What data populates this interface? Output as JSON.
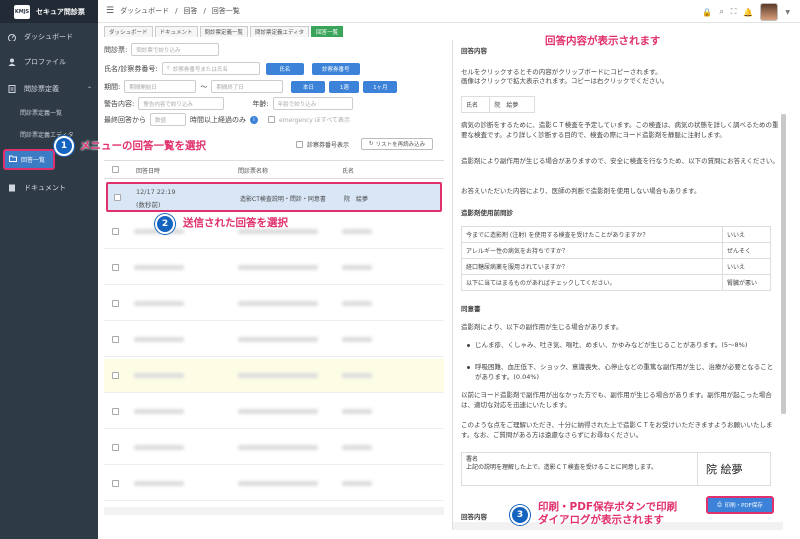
{
  "app": {
    "name": "セキュア問診票",
    "logo": "KMJS"
  },
  "sidebar": {
    "items": [
      {
        "label": "ダッシュボード",
        "icon": "dashboard-icon"
      },
      {
        "label": "プロファイル",
        "icon": "user-icon"
      },
      {
        "label": "問診票定義",
        "icon": "doc-icon"
      }
    ],
    "subitems": [
      "問診票定義一覧",
      "問診票定義エディタ"
    ],
    "active": "回答一覧",
    "document": "ドキュメント"
  },
  "breadcrumb": [
    "ダッシュボード",
    "回答",
    "回答一覧"
  ],
  "tabs": [
    "ダッシュボード",
    "ドキュメント",
    "問診票定義一覧",
    "問診票定義エディタ",
    "回答一覧"
  ],
  "filters": {
    "questionnaire_label": "問診票:",
    "questionnaire_ph": "問診票で絞り込み",
    "name_label": "氏名/診察券番号:",
    "name_ph": "診察券番号または氏名",
    "name_btn": "氏名",
    "card_btn": "診察券番号",
    "period_label": "期間:",
    "period_from_ph": "期間開始日",
    "tilde": "〜",
    "period_to_ph": "期間終了日",
    "today_btn": "本日",
    "week_btn": "1週",
    "month_btn": "1ヶ月",
    "warning_label": "警告内容:",
    "warning_ph": "警告内容で絞り込み",
    "age_label": "年齢:",
    "age_ph": "年齢で絞り込み",
    "last_label": "最終回答から",
    "last_ph": "数値",
    "hours_label": "時間以上経過のみ",
    "emergency": "emergency ほすべて表示",
    "show_card": "診察券番号表示",
    "reload": "リストを再読み込み"
  },
  "table": {
    "headers": [
      "回答日時",
      "問診票名称",
      "氏名"
    ],
    "selected": {
      "datetime": "12/17 22:19",
      "relative": "(数秒前)",
      "name": "造影CT検査説明・問診・同意書",
      "patient": "院　絵夢"
    }
  },
  "right": {
    "title": "回答内容",
    "intro1": "セルをクリックするとその内容がクリップボードにコピーされます。",
    "intro2": "画像はクリックで拡大表示されます。コピーは右クリックでください。",
    "name_label": "氏名",
    "name_value": "院　絵夢",
    "p1": "病気の診断をするために、造影ＣＴ検査を予定しています。この検査は、病気の状態を詳しく調べるための重要な検査です。より詳しく診断する目的で、検査の際にヨード造影剤を静脈に注射します。",
    "p2": "造影剤により副作用が生じる場合がありますので、安全に検査を行なうため、以下の質問にお答えください。",
    "p3": "お答えいただいた内容により、医師の判断で造影剤を使用しない場合もあります。",
    "sec1": "造影剤使用前問診",
    "qa": [
      [
        "今までに造影剤 (注射) を使用する検査を受けたことがありますか？",
        "いいえ"
      ],
      [
        "アレルギー性の病気をお持ちですか？",
        "ぜんそく"
      ],
      [
        "経口糖尿病薬を服用されていますか？",
        "いいえ"
      ],
      [
        "以下に当てはまるものがあればチェックしてください。",
        "腎臓が悪い"
      ]
    ],
    "sec2": "同意書",
    "p4": "造影剤により、以下の副作用が生じる場合があります。",
    "b1": "じんま疹、くしゃみ、吐き気、嘔吐、めまい、かゆみなどが生じることがあります。(5〜8%)",
    "b2": "呼吸困難、血圧低下、ショック、意識喪失、心停止などの重篤な副作用が生じ、治療が必要となることがあります。(0.04%)",
    "p5": "以前にヨード造影剤で副作用が出なかった方でも、副作用が生じる場合があります。副作用が起こった場合は、適切な対応を迅速にいたします。",
    "p6": "このような点をご理解いただき、十分に納得された上で造影ＣＴをお受けいただきますようお願いいたします。なお、ご質問がある方は遠慮なさらずにお尋ねください。",
    "sig_label": "署名",
    "sig_text": "上記の説明を理解した上で、造影ＣＴ検査を受けることに同意します。",
    "sig_value": "院 絵夢",
    "next_title": "回答内容",
    "print_btn": "印刷・PDF保存"
  },
  "annotations": {
    "top": "回答内容が表示されます",
    "step1": "メニューの回答一覧を選択",
    "step2": "送信された回答を選択",
    "step3a": "印刷・PDF保存ボタンで印刷",
    "step3b": "ダイアログが表示されます",
    "n1": "1",
    "n2": "2",
    "n3": "3"
  },
  "colors": {
    "accent": "#e0306e",
    "primary": "#3b82d8",
    "badge": "#1565c0",
    "sidebar": "#2f3a47"
  }
}
